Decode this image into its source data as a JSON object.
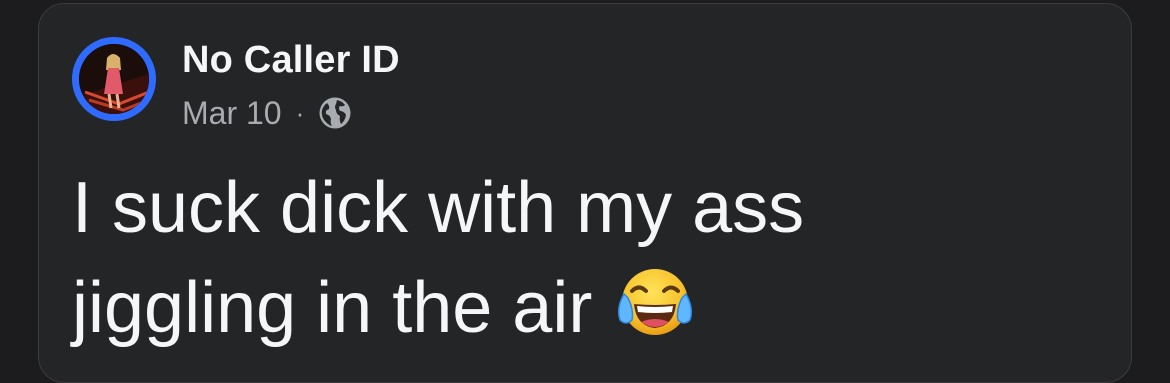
{
  "post": {
    "author": "No Caller ID",
    "date": "Mar 10",
    "separator": "·",
    "privacy_icon": "globe-icon",
    "text_line1": "I suck dick with my ass",
    "text_line2": "jiggling in the air",
    "emoji": "face-with-tears-of-joy-icon"
  },
  "colors": {
    "background": "#1c1c1e",
    "card": "#242526",
    "avatar_ring": "#2f6bff",
    "primary_text": "#f5f6f7",
    "secondary_text": "#a8abaf"
  }
}
